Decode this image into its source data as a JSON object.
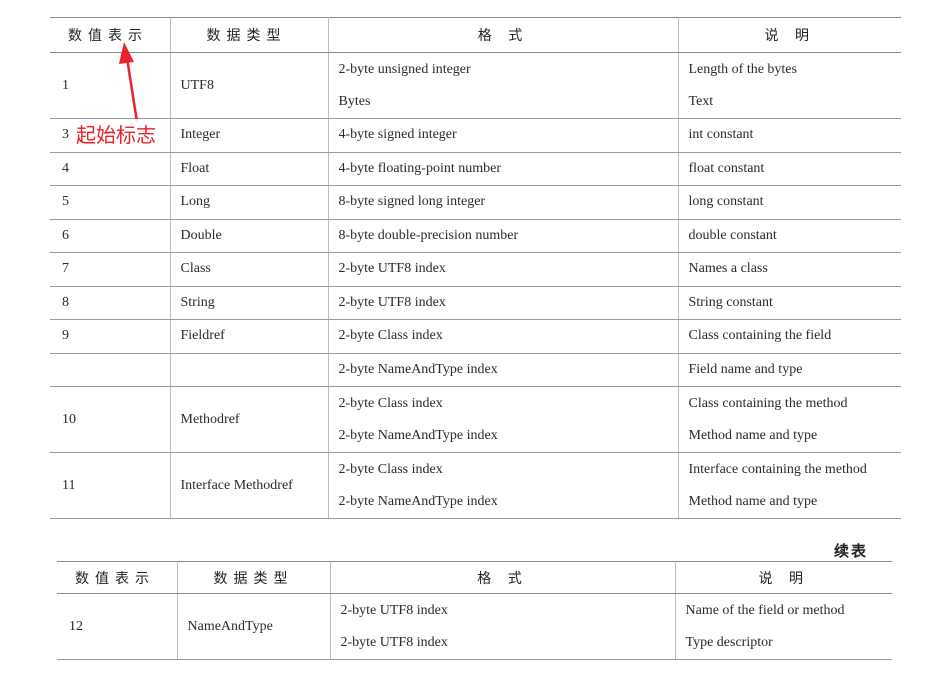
{
  "headers": [
    "数值表示",
    "数据类型",
    "格  式",
    "说  明"
  ],
  "rows": [
    {
      "value": "1",
      "type": "UTF8",
      "formats": [
        "2-byte unsigned integer",
        "Bytes"
      ],
      "descs": [
        "Length of the bytes",
        "Text"
      ]
    },
    {
      "value": "3",
      "type": "Integer",
      "formats": [
        "4-byte signed integer"
      ],
      "descs": [
        "int constant"
      ]
    },
    {
      "value": "4",
      "type": "Float",
      "formats": [
        "4-byte floating-point number"
      ],
      "descs": [
        "float constant"
      ]
    },
    {
      "value": "5",
      "type": "Long",
      "formats": [
        "8-byte signed long integer"
      ],
      "descs": [
        "long constant"
      ]
    },
    {
      "value": "6",
      "type": "Double",
      "formats": [
        "8-byte double-precision number"
      ],
      "descs": [
        "double constant"
      ]
    },
    {
      "value": "7",
      "type": "Class",
      "formats": [
        "2-byte UTF8 index"
      ],
      "descs": [
        "Names a class"
      ]
    },
    {
      "value": "8",
      "type": "String",
      "formats": [
        "2-byte UTF8 index"
      ],
      "descs": [
        "String constant"
      ]
    },
    {
      "value": "9",
      "type": "Fieldref",
      "formats": [
        "2-byte Class index"
      ],
      "descs": [
        "Class containing the field"
      ]
    },
    {
      "value": "",
      "type": "",
      "formats": [
        "2-byte NameAndType index"
      ],
      "descs": [
        "Field name and type"
      ]
    },
    {
      "value": "10",
      "type": "Methodref",
      "formats": [
        "2-byte Class index",
        "2-byte NameAndType index"
      ],
      "descs": [
        "Class containing the method",
        "Method name and type"
      ]
    },
    {
      "value": "11",
      "type": "Interface Methodref",
      "formats": [
        "2-byte Class index",
        "2-byte NameAndType index"
      ],
      "descs": [
        "Interface containing the method",
        "Method name and type"
      ]
    }
  ],
  "continued_label": "续表",
  "rows2": [
    {
      "value": "12",
      "type": "NameAndType",
      "formats": [
        "2-byte UTF8 index",
        "2-byte UTF8 index"
      ],
      "descs": [
        "Name of the field or method",
        "Type descriptor"
      ]
    }
  ],
  "annotation": {
    "text": "起始标志",
    "color": "#e8232a"
  }
}
